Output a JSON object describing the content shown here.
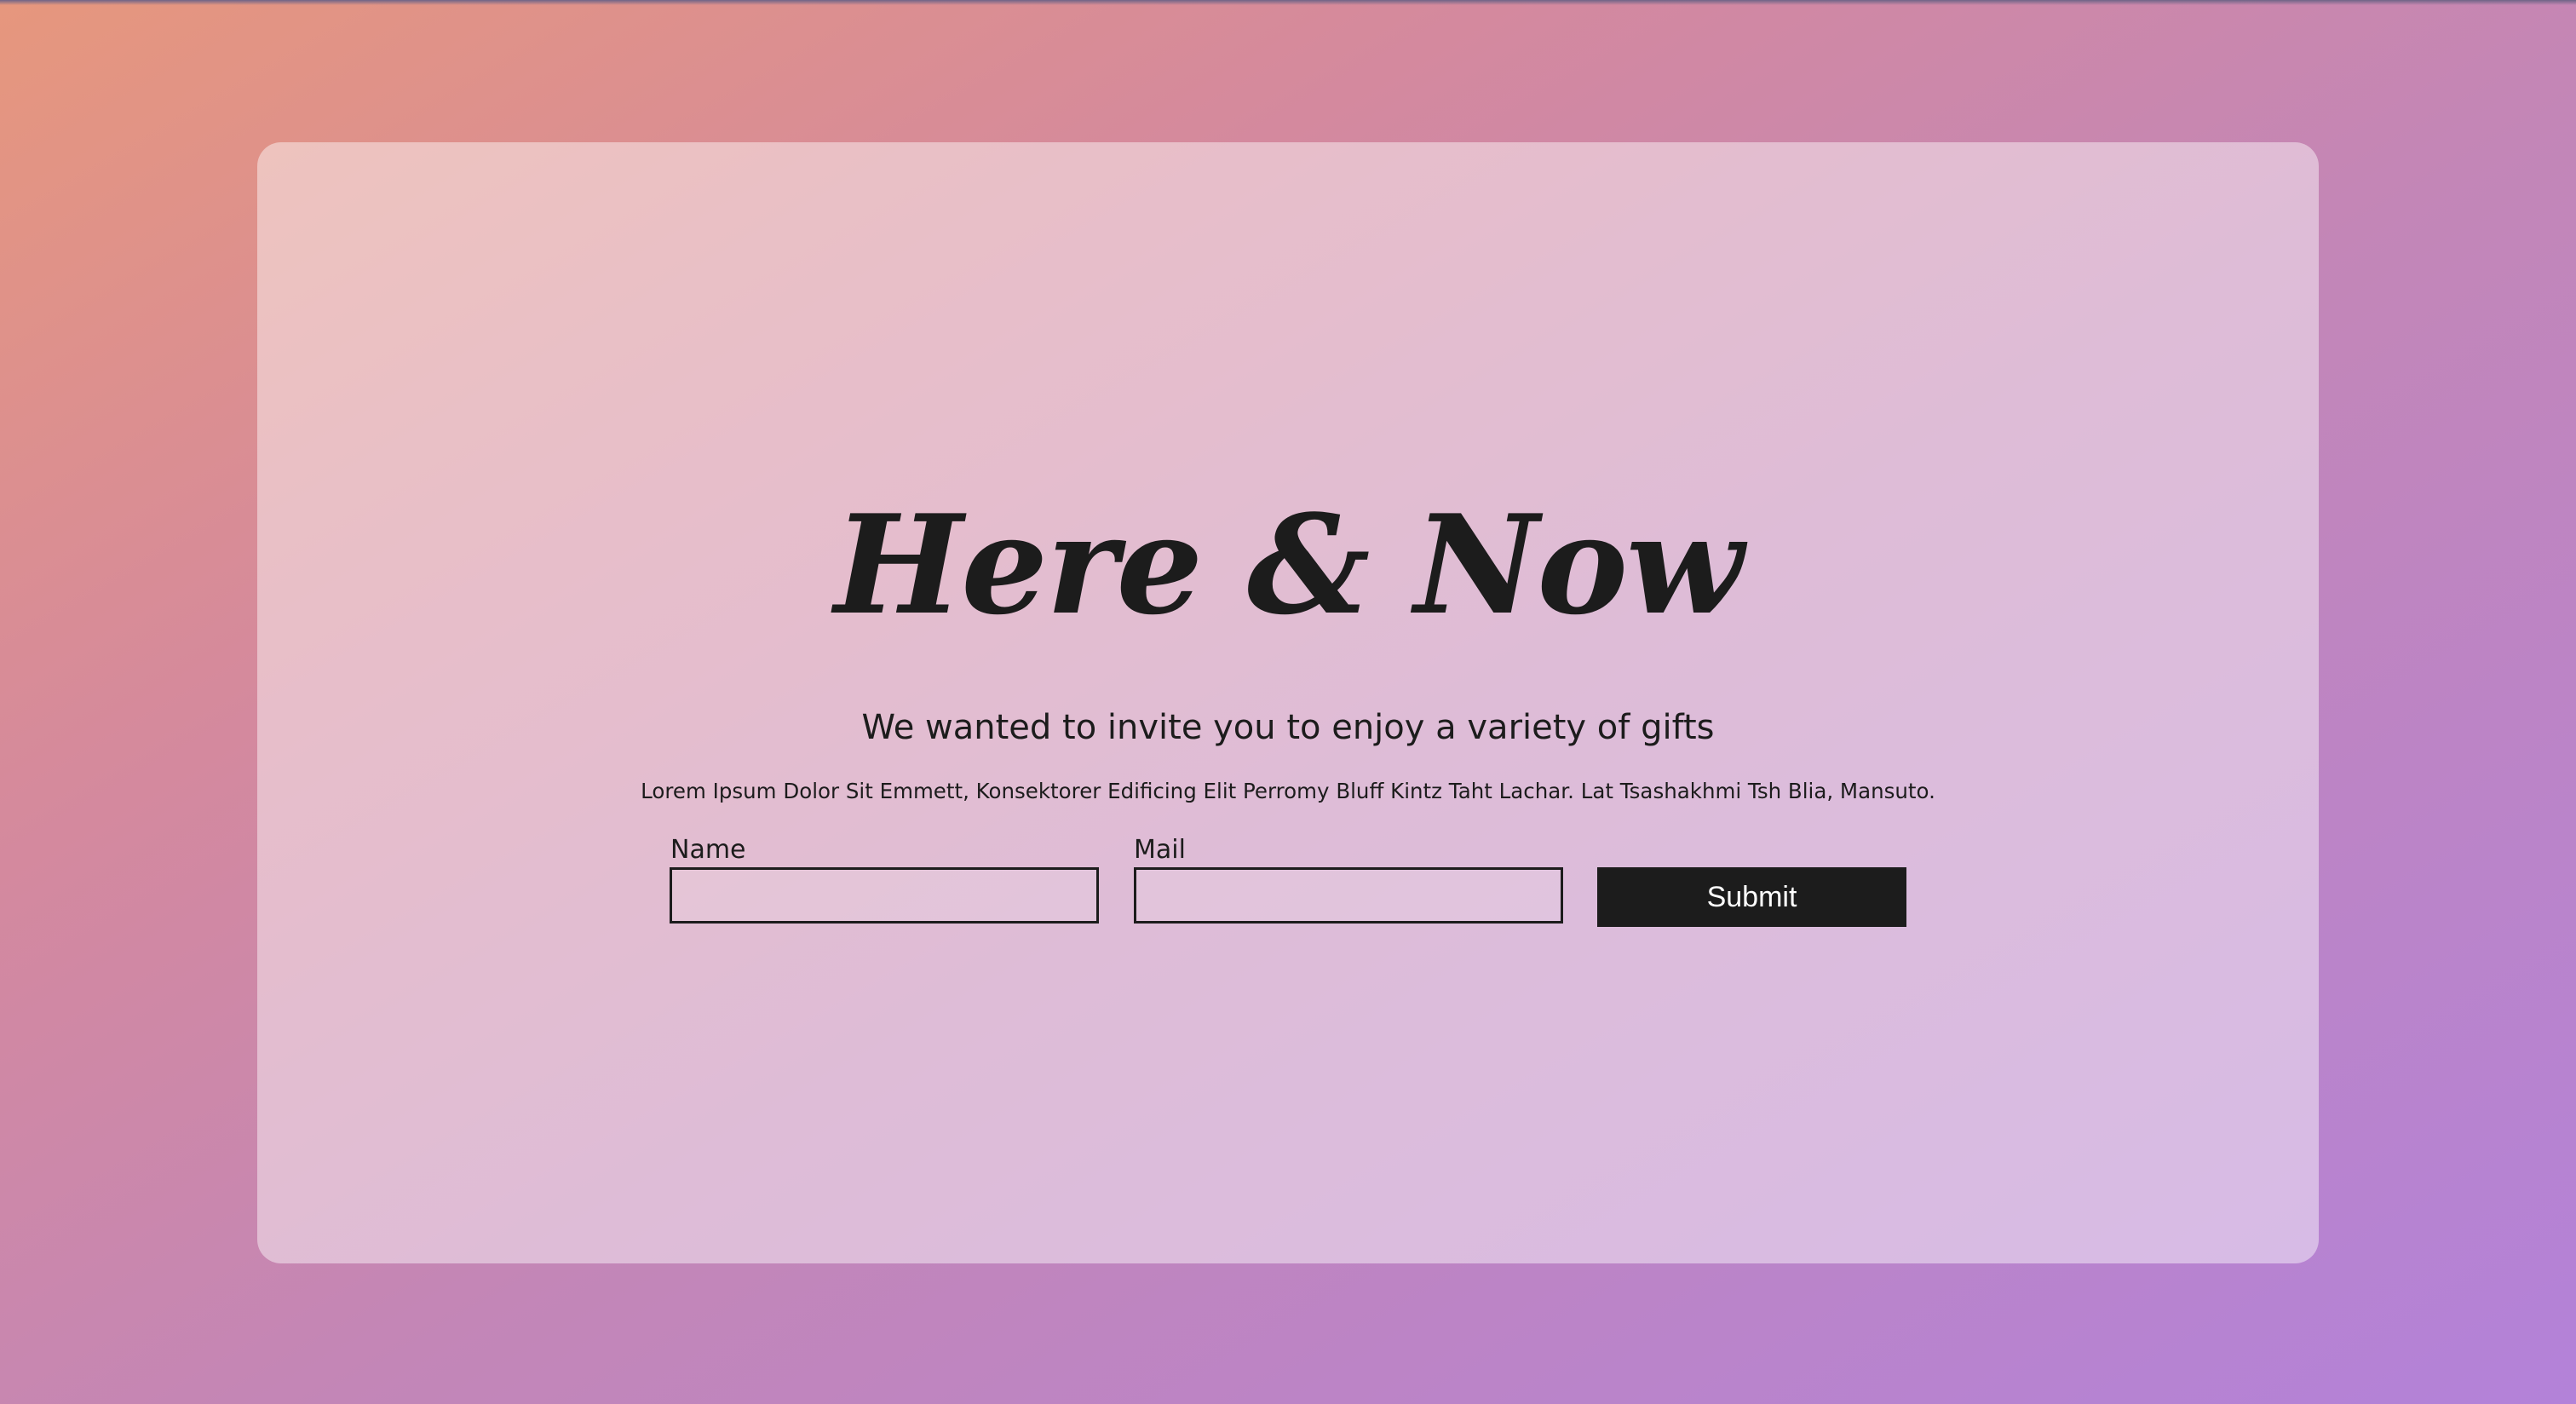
{
  "hero": {
    "title": "Here & Now",
    "subtitle": "We wanted to invite you to enjoy a variety of gifts",
    "body": "Lorem Ipsum Dolor Sit Emmett, Konsektorer Edificing Elit Perromy Bluff Kintz Taht Lachar. Lat Tsashakhmi Tsh Blia, Mansuto."
  },
  "form": {
    "name_label": "Name",
    "name_value": "",
    "mail_label": "Mail",
    "mail_value": "",
    "submit_label": "Submit"
  },
  "colors": {
    "background_start": "#e6977d",
    "background_end": "#b382d9",
    "text": "#1c1c1c",
    "button_bg": "#1c1c1c",
    "button_text": "#ffffff"
  }
}
